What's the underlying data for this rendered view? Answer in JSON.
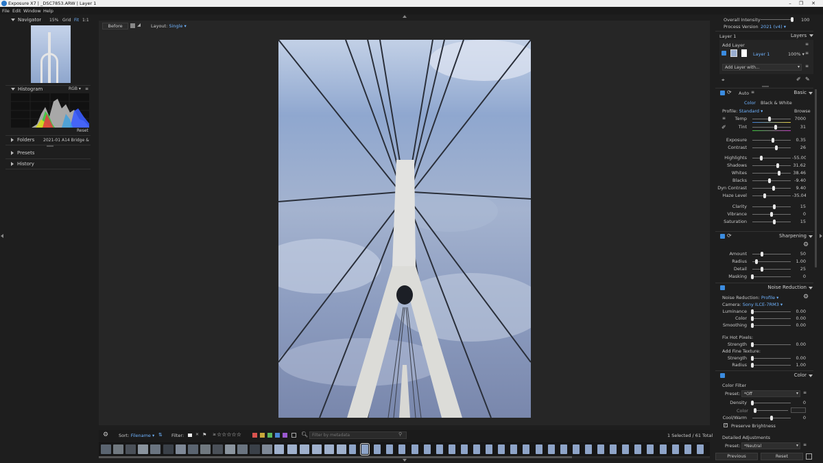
{
  "window": {
    "title": "Exposure X7 | _DSC7853.ARW | Layer 1"
  },
  "menu": [
    "File",
    "Edit",
    "Window",
    "Help"
  ],
  "navigator": {
    "title": "Navigator",
    "zoom": "15%",
    "grid": "Grid",
    "fit": "Fit",
    "one": "1:1"
  },
  "histogram": {
    "title": "Histogram",
    "mode": "RGB",
    "reset": "Reset"
  },
  "folders": {
    "title": "Folders",
    "current": "2021-01 A14 Bridge & ..."
  },
  "presets": {
    "title": "Presets"
  },
  "history": {
    "title": "History"
  },
  "toolbar": {
    "before": "Before",
    "layout_label": "Layout:",
    "layout_value": "Single"
  },
  "filmbar": {
    "sort_label": "Sort:",
    "sort_value": "Filename",
    "filter_label": "Filter:",
    "stars": "☆☆☆☆☆",
    "search_placeholder": "Filter by metadata",
    "selected": "1 Selected / 61 Total",
    "colors": [
      "#d9534f",
      "#c9a83a",
      "#5cb85c",
      "#4a87d6",
      "#9b59d0"
    ]
  },
  "right": {
    "overall_intensity": {
      "label": "Overall Intensity",
      "value": "100",
      "pos": 1.0
    },
    "process_version": {
      "label": "Process Version",
      "value": "2021 (v4)"
    },
    "layers": {
      "layer_name": "Layer 1",
      "title": "Layers",
      "add_layer": "Add Layer",
      "layer_label": "Layer 1",
      "opacity": "100%",
      "add_with": "Add Layer with..."
    },
    "basic": {
      "auto": "Auto",
      "title": "Basic",
      "color": "Color",
      "bw": "Black & White",
      "profile_label": "Profile:",
      "profile_value": "Standard",
      "browse": "Browse",
      "temp": {
        "label": "Temp",
        "value": "7000",
        "pos": 0.45
      },
      "tint": {
        "label": "Tint",
        "value": "31",
        "pos": 0.6
      },
      "exposure": {
        "label": "Exposure",
        "value": "0.35",
        "pos": 0.54
      },
      "contrast": {
        "label": "Contrast",
        "value": "26",
        "pos": 0.63
      },
      "highlights": {
        "label": "Highlights",
        "value": "-55.00",
        "pos": 0.23
      },
      "shadows": {
        "label": "Shadows",
        "value": "31.62",
        "pos": 0.66
      },
      "whites": {
        "label": "Whites",
        "value": "38.46",
        "pos": 0.69
      },
      "blacks": {
        "label": "Blacks",
        "value": "-9.40",
        "pos": 0.45
      },
      "dyn_contrast": {
        "label": "Dyn Contrast",
        "value": "9.40",
        "pos": 0.55
      },
      "haze": {
        "label": "Haze Level",
        "value": "-35.04",
        "pos": 0.32
      },
      "clarity": {
        "label": "Clarity",
        "value": "15",
        "pos": 0.58
      },
      "vibrance": {
        "label": "Vibrance",
        "value": "0",
        "pos": 0.5
      },
      "saturation": {
        "label": "Saturation",
        "value": "15",
        "pos": 0.58
      }
    },
    "sharpening": {
      "title": "Sharpening",
      "amount": {
        "label": "Amount",
        "value": "50",
        "pos": 0.25
      },
      "radius": {
        "label": "Radius",
        "value": "1.00",
        "pos": 0.1
      },
      "detail": {
        "label": "Detail",
        "value": "25",
        "pos": 0.25
      },
      "masking": {
        "label": "Masking",
        "value": "0",
        "pos": 0.0
      }
    },
    "noise": {
      "title": "Noise Reduction",
      "nr_label": "Noise Reduction:",
      "nr_value": "Profile",
      "camera_label": "Camera:",
      "camera_value": "Sony ILCE-7RM3",
      "luminance": {
        "label": "Luminance",
        "value": "0.00",
        "pos": 0.0
      },
      "color": {
        "label": "Color",
        "value": "0.00",
        "pos": 0.0
      },
      "smoothing": {
        "label": "Smoothing",
        "value": "0.00",
        "pos": 0.0
      },
      "hot_pixels": "Fix Hot Pixels:",
      "hp_strength": {
        "label": "Strength",
        "value": "0.00",
        "pos": 0.0
      },
      "fine_texture": "Add Fine Texture:",
      "ft_strength": {
        "label": "Strength",
        "value": "0.00",
        "pos": 0.0
      },
      "ft_radius": {
        "label": "Radius",
        "value": "1.00",
        "pos": 0.0
      }
    },
    "color": {
      "title": "Color",
      "filter": "Color Filter",
      "preset_label": "Preset:",
      "preset_value": "*Off",
      "density": {
        "label": "Density",
        "value": "0",
        "pos": 0.0
      },
      "color_label": "Color",
      "coolwarm": {
        "label": "Cool/Warm",
        "value": "0",
        "pos": 0.5
      },
      "preserve": "Preserve Brightness",
      "detailed": "Detailed Adjustments",
      "preset2_label": "Preset:",
      "preset2_value": "*Neutral"
    },
    "footer": {
      "previous": "Previous",
      "reset": "Reset"
    }
  }
}
